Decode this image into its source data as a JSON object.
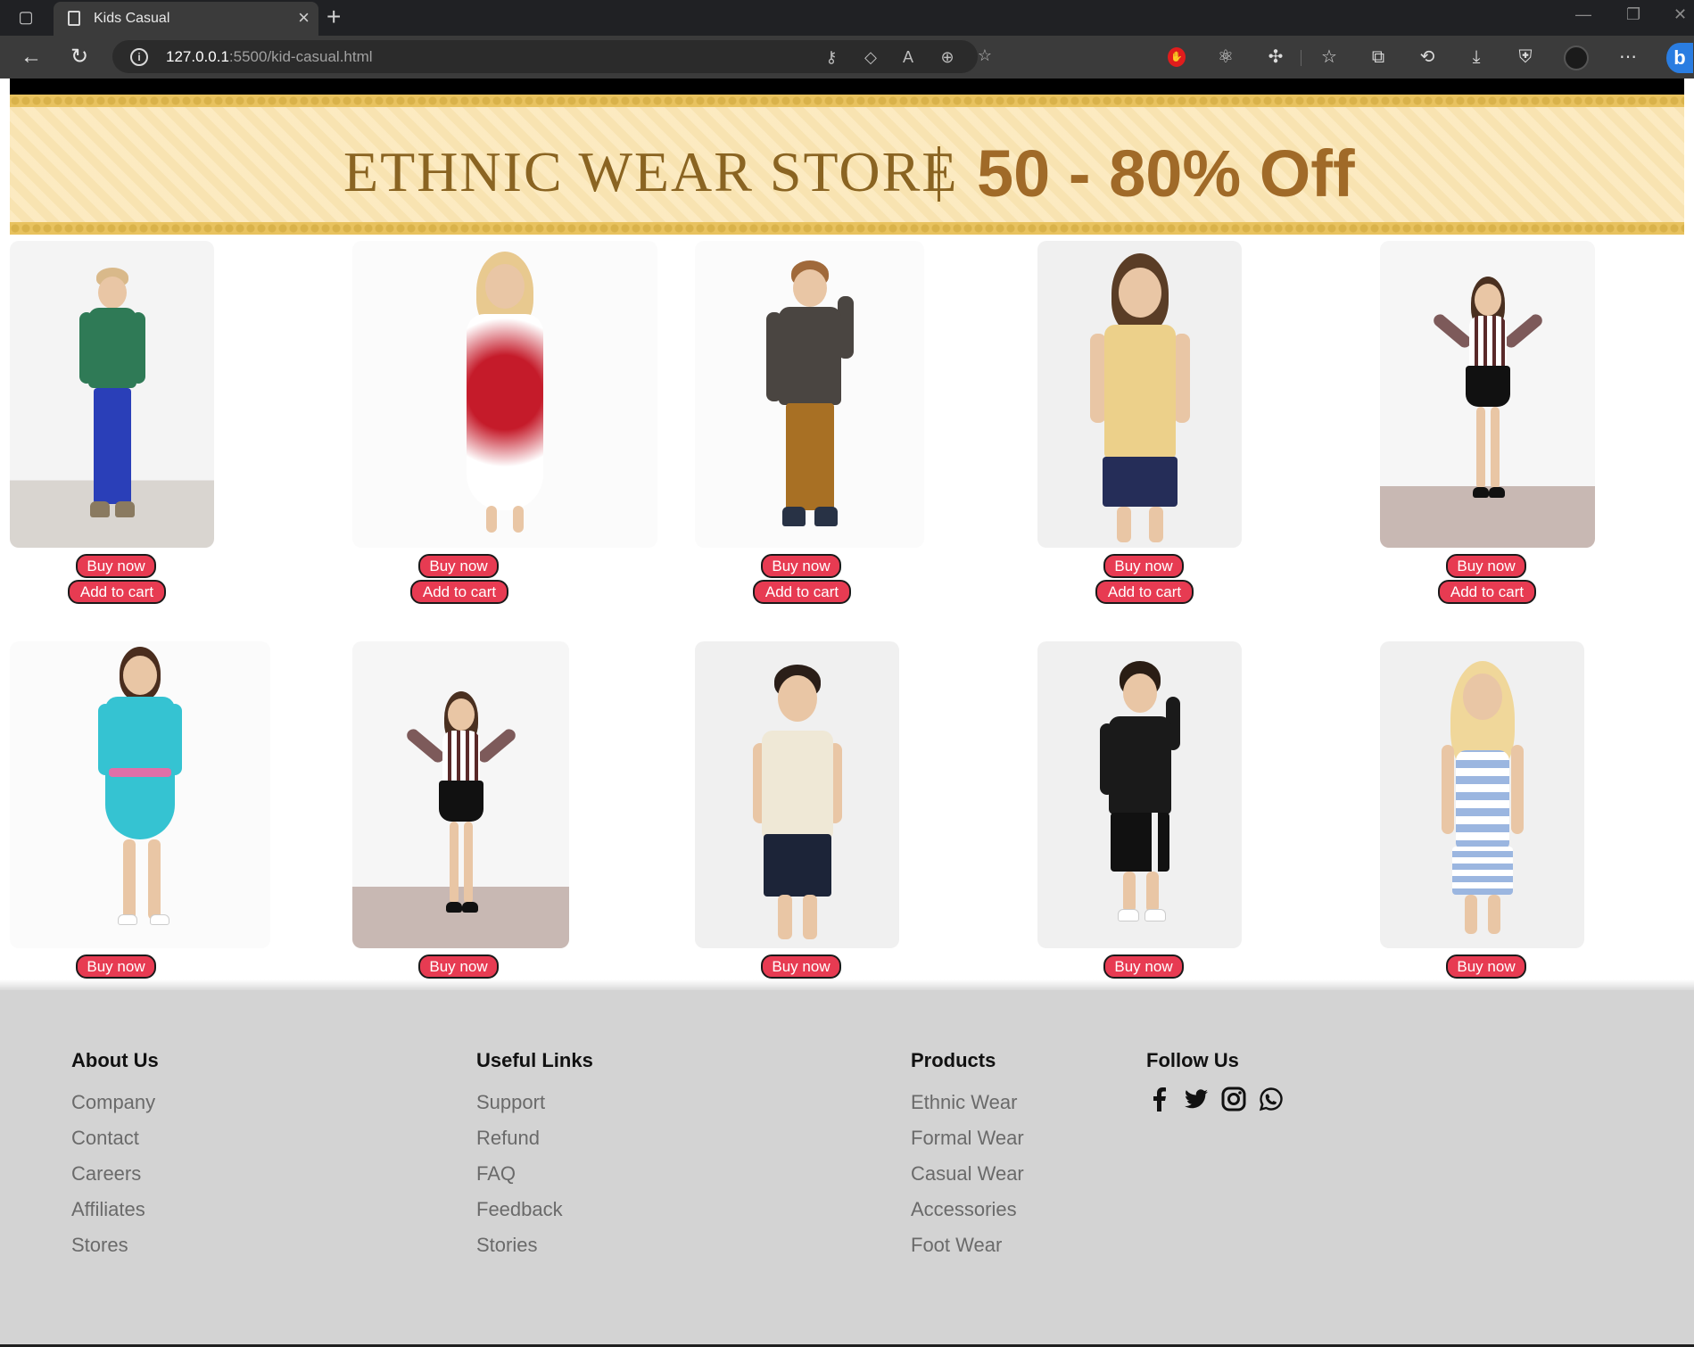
{
  "browser": {
    "tab_title": "Kids Casual",
    "url_host": "127.0.0.1",
    "url_path": ":5500/kid-casual.html"
  },
  "banner": {
    "store_text": "ETHNIC WEAR STORE",
    "offer_text": "50 - 80% Off"
  },
  "products": {
    "buy_label": "Buy now",
    "cart_label": "Add to cart",
    "row1": [
      "boy-green-hoodie",
      "girl-heart-dress",
      "boy-brown-sweater",
      "boy-sunshine-tank",
      "girl-plaid-shirt"
    ],
    "row2": [
      "girl-teal-dress",
      "girl-plaid-shirt-2",
      "boy-cream-tee",
      "boy-space-jam-tee",
      "girl-striped-set"
    ]
  },
  "footer": {
    "about": {
      "title": "About Us",
      "links": [
        "Company",
        "Contact",
        "Careers",
        "Affiliates",
        "Stores"
      ]
    },
    "useful": {
      "title": "Useful Links",
      "links": [
        "Support",
        "Refund",
        "FAQ",
        "Feedback",
        "Stories"
      ]
    },
    "products": {
      "title": "Products",
      "links": [
        "Ethnic Wear",
        "Formal Wear",
        "Casual Wear",
        "Accessories",
        "Foot Wear"
      ]
    },
    "follow": {
      "title": "Follow Us",
      "icons": [
        "facebook-icon",
        "twitter-icon",
        "instagram-icon",
        "whatsapp-icon"
      ]
    }
  },
  "colors": {
    "button": "#e73b52",
    "footer_bg": "#d3d3d3",
    "banner_text": "#8a6422"
  }
}
